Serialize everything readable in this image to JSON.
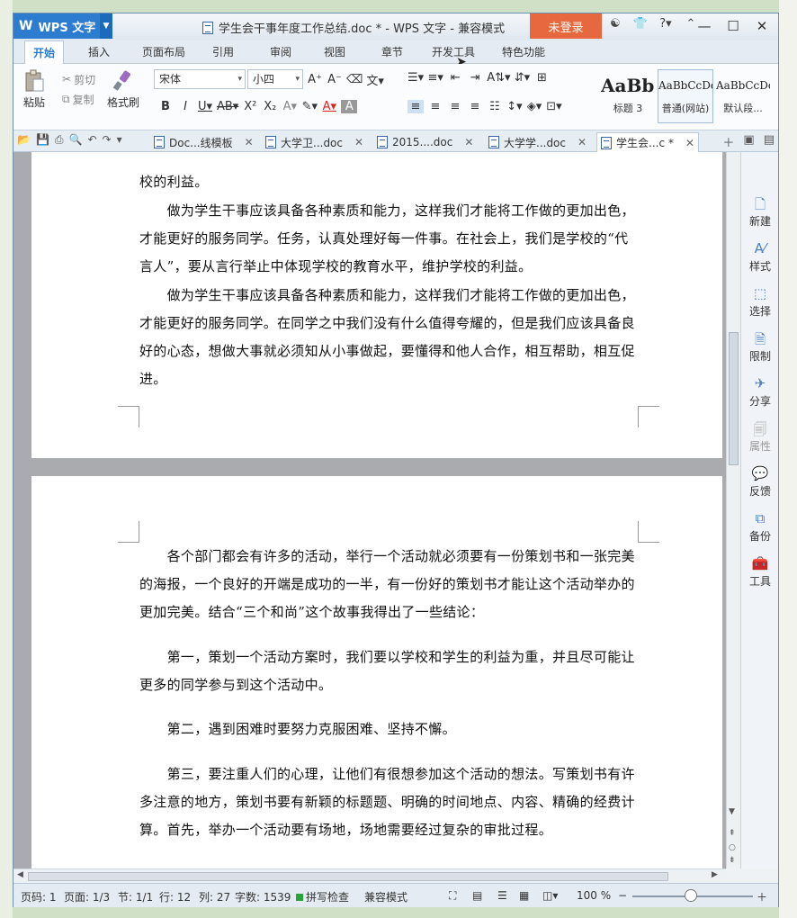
{
  "app": {
    "name": "WPS 文字",
    "title": "学生会干事年度工作总结.doc * - WPS 文字 - 兼容模式",
    "login": "未登录"
  },
  "menu": [
    "开始",
    "插入",
    "页面布局",
    "引用",
    "审阅",
    "视图",
    "章节",
    "开发工具",
    "特色功能"
  ],
  "ribbon": {
    "paste": "粘贴",
    "cut": "剪切",
    "copy": "复制",
    "format_painter": "格式刷",
    "font": "宋体",
    "size": "小四",
    "styles": [
      {
        "sample": "AaBbC",
        "name": "标题 3"
      },
      {
        "sample": "AaBbCcDd",
        "name": "普通(网站)"
      },
      {
        "sample": "AaBbCcDd",
        "name": "默认段..."
      }
    ]
  },
  "doc_tabs": [
    {
      "label": "Doc...线模板"
    },
    {
      "label": "大学卫...doc"
    },
    {
      "label": "2015....doc"
    },
    {
      "label": "大学学...doc"
    },
    {
      "label": "学生会...c *"
    }
  ],
  "page1": {
    "paragraphs": [
      "校的利益。",
      "　　做为学生干事应该具备各种素质和能力，这样我们才能将工作做的更加出色，才能更好的服务同学。任务，认真处理好每一件事。在社会上，我们是学校的“代言人”，要从言行举止中体现学校的教育水平，维护学校的利益。",
      "　　做为学生干事应该具备各种素质和能力，这样我们才能将工作做的更加出色，才能更好的服务同学。在同学之中我们没有什么值得夸耀的，但是我们应该具备良好的心态，想做大事就必须知从小事做起，要懂得和他人合作，相互帮助，相互促进。"
    ]
  },
  "page2": {
    "paragraphs": [
      "　　各个部门都会有许多的活动，举行一个活动就必须要有一份策划书和一张完美的海报，一个良好的开端是成功的一半，有一份好的策划书才能让这个活动举办的更加完美。结合“三个和尚”这个故事我得出了一些结论：",
      "　　第一，策划一个活动方案时，我们要以学校和学生的利益为重，并且尽可能让更多的同学参与到这个活动中。",
      "　　第二，遇到困难时要努力克服困难、坚持不懈。",
      "　　第三，要注重人们的心理，让他们有很想参加这个活动的想法。写策划书有许多注意的地方，策划书要有新颖的标题题、明确的时间地点、内容、精确的经费计算。首先，举办一个活动要有场地，场地需要经过复杂的审批过程。"
    ]
  },
  "taskpane": [
    "新建",
    "样式",
    "选择",
    "限制",
    "分享",
    "属性",
    "反馈",
    "备份",
    "工具"
  ],
  "status": {
    "page_code": "页码: 1",
    "pages": "页面: 1/3",
    "section": "节: 1/1",
    "line": "行: 12",
    "col": "列: 27",
    "words": "字数: 1539",
    "spell": "拼写检查",
    "mode": "兼容模式",
    "zoom": "100 %"
  },
  "colors": {
    "accent": "#2c7ccf",
    "login": "#e7683e"
  },
  "zoom_level": 100
}
